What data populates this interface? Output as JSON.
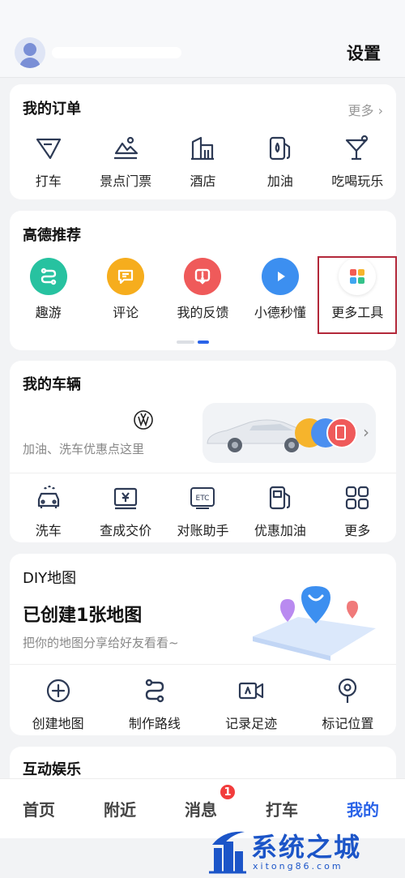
{
  "header": {
    "settings_label": "设置"
  },
  "orders": {
    "title": "我的订单",
    "more": "更多",
    "items": [
      {
        "label": "打车",
        "icon": "taxi-icon"
      },
      {
        "label": "景点门票",
        "icon": "scenic-ticket-icon"
      },
      {
        "label": "酒店",
        "icon": "hotel-icon"
      },
      {
        "label": "加油",
        "icon": "fuel-icon"
      },
      {
        "label": "吃喝玩乐",
        "icon": "cocktail-icon"
      }
    ]
  },
  "recommend": {
    "title": "高德推荐",
    "items": [
      {
        "label": "趣游",
        "icon": "route-icon",
        "color": "#27c2a0"
      },
      {
        "label": "评论",
        "icon": "comment-icon",
        "color": "#f6ad1d"
      },
      {
        "label": "我的反馈",
        "icon": "feedback-icon",
        "color": "#ef5a5a"
      },
      {
        "label": "小德秒懂",
        "icon": "play-icon",
        "color": "#3c8ff0"
      },
      {
        "label": "更多工具",
        "icon": "apps-grid-icon",
        "color": "#ffffff"
      }
    ]
  },
  "vehicle": {
    "title": "我的车辆",
    "subtitle": "加油、洗车优惠点这里",
    "items": [
      {
        "label": "洗车",
        "icon": "car-wash-icon"
      },
      {
        "label": "查成交价",
        "icon": "price-icon"
      },
      {
        "label": "对账助手",
        "icon": "etc-icon"
      },
      {
        "label": "优惠加油",
        "icon": "fuel-icon"
      },
      {
        "label": "更多",
        "icon": "grid-icon"
      }
    ]
  },
  "diy": {
    "title_small": "DIY地图",
    "title": "已创建1张地图",
    "subtitle": "把你的地图分享给好友看看~",
    "items": [
      {
        "label": "创建地图",
        "icon": "plus-circle-icon"
      },
      {
        "label": "制作路线",
        "icon": "route-icon"
      },
      {
        "label": "记录足迹",
        "icon": "video-icon"
      },
      {
        "label": "标记位置",
        "icon": "pin-icon"
      }
    ]
  },
  "entertainment": {
    "title": "互动娱乐"
  },
  "tabs": {
    "items": [
      {
        "label": "首页"
      },
      {
        "label": "附近"
      },
      {
        "label": "消息"
      },
      {
        "label": "打车"
      },
      {
        "label": "我的"
      }
    ],
    "active": "我的",
    "message_badge": "1"
  },
  "watermark": {
    "text": "系统之城",
    "url": "xitong86.com"
  },
  "colors": {
    "accent": "#2a63e8",
    "highlight_box": "#b3283a",
    "badge": "#f23c3c"
  }
}
